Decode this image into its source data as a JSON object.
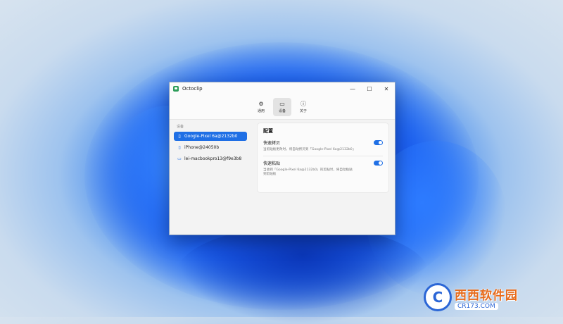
{
  "window": {
    "title": "Octoclip"
  },
  "toolbar": {
    "items": [
      {
        "label": "通用",
        "icon": "gear-icon"
      },
      {
        "label": "设备",
        "icon": "devices-icon"
      },
      {
        "label": "关于",
        "icon": "info-icon"
      }
    ]
  },
  "sidebar": {
    "heading": "设备",
    "devices": [
      {
        "name": "Google-Pixel 6a@2132b0",
        "icon": "phone-icon",
        "selected": true
      },
      {
        "name": "iPhone@24050b",
        "icon": "phone-icon",
        "selected": false
      },
      {
        "name": "lei-macbookpro13@f9e3b8",
        "icon": "laptop-icon",
        "selected": false
      }
    ]
  },
  "config": {
    "title": "配置",
    "options": [
      {
        "label": "快速拷贝",
        "description": "当剪贴板更改时，将自动拷贝到「Google-Pixel 6a@2132b0」",
        "enabled": true
      },
      {
        "label": "快速粘贴",
        "description": "当收到「Google-Pixel 6a@2132b0」的剪贴时，将自动粘贴到剪贴板",
        "enabled": true
      }
    ]
  },
  "watermark": {
    "name": "西西软件园",
    "url": "CR173.COM",
    "logo_letter": "C"
  },
  "colors": {
    "accent": "#1f6fe5",
    "window_bg": "#f3f3f3"
  }
}
